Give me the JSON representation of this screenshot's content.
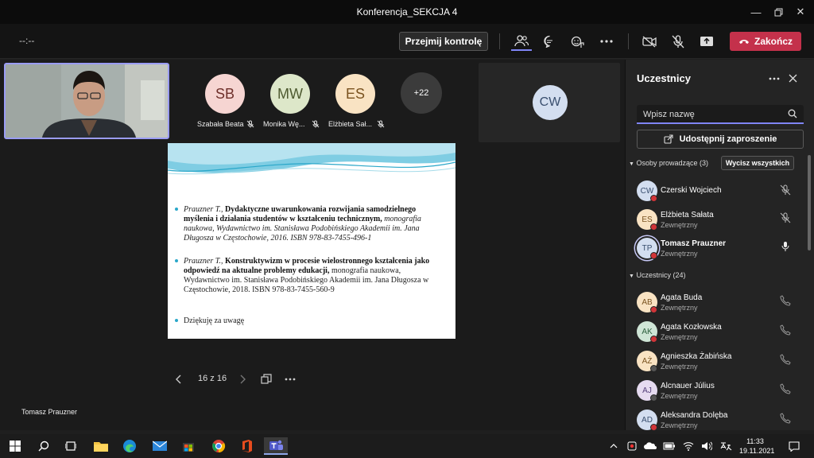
{
  "window": {
    "title": "Konferencja_SEKCJA 4"
  },
  "toolbar": {
    "timer": "--:--",
    "take_control": "Przejmij kontrolę",
    "end_call": "Zakończ"
  },
  "stage": {
    "participants": [
      {
        "initials": "SB",
        "name": "Szabała Beata",
        "color": "#f6d5d2"
      },
      {
        "initials": "MW",
        "name": "Monika Wę...",
        "color": "#dde7c9"
      },
      {
        "initials": "ES",
        "name": "Elżbieta Sał...",
        "color": "#f9e3c3"
      }
    ],
    "overflow_count": "+22",
    "tile_initials": "CW",
    "presenter_name": "Tomasz Prauzner",
    "pager": "16 z 16"
  },
  "slide": {
    "refs": [
      {
        "author": "Prauzner T.,",
        "title": "Dydaktyczne uwarunkowania rozwijania samodzielnego myślenia i działania studentów w kształceniu technicznym,",
        "rest": "monografia naukowa, Wydawnictwo im. Stanisława Podobińskiego Akademii im. Jana Długosza w Częstochowie, 2016. ISBN 978-83-7455-496-1"
      },
      {
        "author": "Prauzner T.,",
        "title": "Konstruktywizm w procesie wielostronnego kształcenia jako odpowiedź na aktualne problemy edukacji,",
        "rest": "monografia naukowa, Wydawnictwo im. Stanisława Podobińskiego Akademii im. Jana Długosza w Częstochowie, 2018. ISBN 978-83-7455-560-9"
      }
    ],
    "thanks": "Dziękuję za uwagę"
  },
  "panel": {
    "title": "Uczestnicy",
    "search_placeholder": "Wpisz nazwę",
    "share_invite": "Udostępnij zaproszenie",
    "presenters_header": "Osoby prowadzące (3)",
    "mute_all": "Wycisz wszystkich",
    "attendees_header": "Uczestnicy (24)",
    "presenters": [
      {
        "initials": "CW",
        "name": "Czerski Wojciech",
        "sub": "",
        "color": "#d3def0",
        "fg": "#394e6e",
        "mic": "off"
      },
      {
        "initials": "ES",
        "name": "Elżbieta Sałata",
        "sub": "Zewnętrzny",
        "color": "#f9e3c3",
        "fg": "#7a5320",
        "mic": "off"
      },
      {
        "initials": "TP",
        "name": "Tomasz Prauzner",
        "sub": "Zewnętrzny",
        "color": "#d3def0",
        "fg": "#394e6e",
        "mic": "on"
      }
    ],
    "attendees": [
      {
        "initials": "AB",
        "name": "Agata Buda",
        "sub": "Zewnętrzny",
        "color": "#f9e3c3",
        "fg": "#7a5320"
      },
      {
        "initials": "AK",
        "name": "Agata Kozłowska",
        "sub": "Zewnętrzny",
        "color": "#cfe5d6",
        "fg": "#2c5e3c"
      },
      {
        "initials": "AŻ",
        "name": "Agnieszka Żabińska",
        "sub": "Zewnętrzny",
        "color": "#f9e3c3",
        "fg": "#7a5320"
      },
      {
        "initials": "AJ",
        "name": "Alcnauer Július",
        "sub": "Zewnętrzny",
        "color": "#e6dbf0",
        "fg": "#55407a"
      },
      {
        "initials": "AD",
        "name": "Aleksandra Dolęba",
        "sub": "Zewnętrzny",
        "color": "#d3def0",
        "fg": "#394e6e"
      }
    ]
  },
  "taskbar": {
    "time": "11:33",
    "date": "19.11.2021"
  }
}
